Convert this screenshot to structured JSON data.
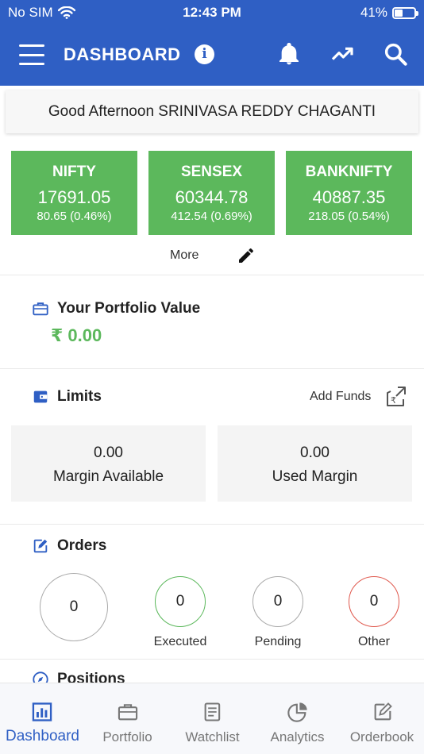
{
  "status_bar": {
    "carrier": "No SIM",
    "time": "12:43 PM",
    "battery": "41%",
    "battery_level": 0.41
  },
  "header": {
    "title": "DASHBOARD"
  },
  "greeting": "Good Afternoon SRINIVASA REDDY CHAGANTI",
  "indices": [
    {
      "name": "NIFTY",
      "value": "17691.05",
      "change": "80.65  (0.46%)"
    },
    {
      "name": "SENSEX",
      "value": "60344.78",
      "change": "412.54  (0.69%)"
    },
    {
      "name": "BANKNIFTY",
      "value": "40887.35",
      "change": "218.05  (0.54%)"
    }
  ],
  "more_label": "More",
  "portfolio": {
    "title": "Your Portfolio Value",
    "value": "₹ 0.00"
  },
  "limits": {
    "title": "Limits",
    "add_funds": "Add Funds",
    "margin_available": {
      "amount": "0.00",
      "label": "Margin Available"
    },
    "used_margin": {
      "amount": "0.00",
      "label": "Used Margin"
    }
  },
  "orders": {
    "title": "Orders",
    "total": "0",
    "executed": {
      "count": "0",
      "label": "Executed"
    },
    "pending": {
      "count": "0",
      "label": "Pending"
    },
    "other": {
      "count": "0",
      "label": "Other"
    }
  },
  "positions": {
    "title": "Positions"
  },
  "nav": [
    "Dashboard",
    "Portfolio",
    "Watchlist",
    "Analytics",
    "Orderbook"
  ],
  "colors": {
    "primary": "#2f5fc4",
    "green": "#5cb85c",
    "red": "#e05a4f",
    "grey": "#aaaaaa"
  }
}
